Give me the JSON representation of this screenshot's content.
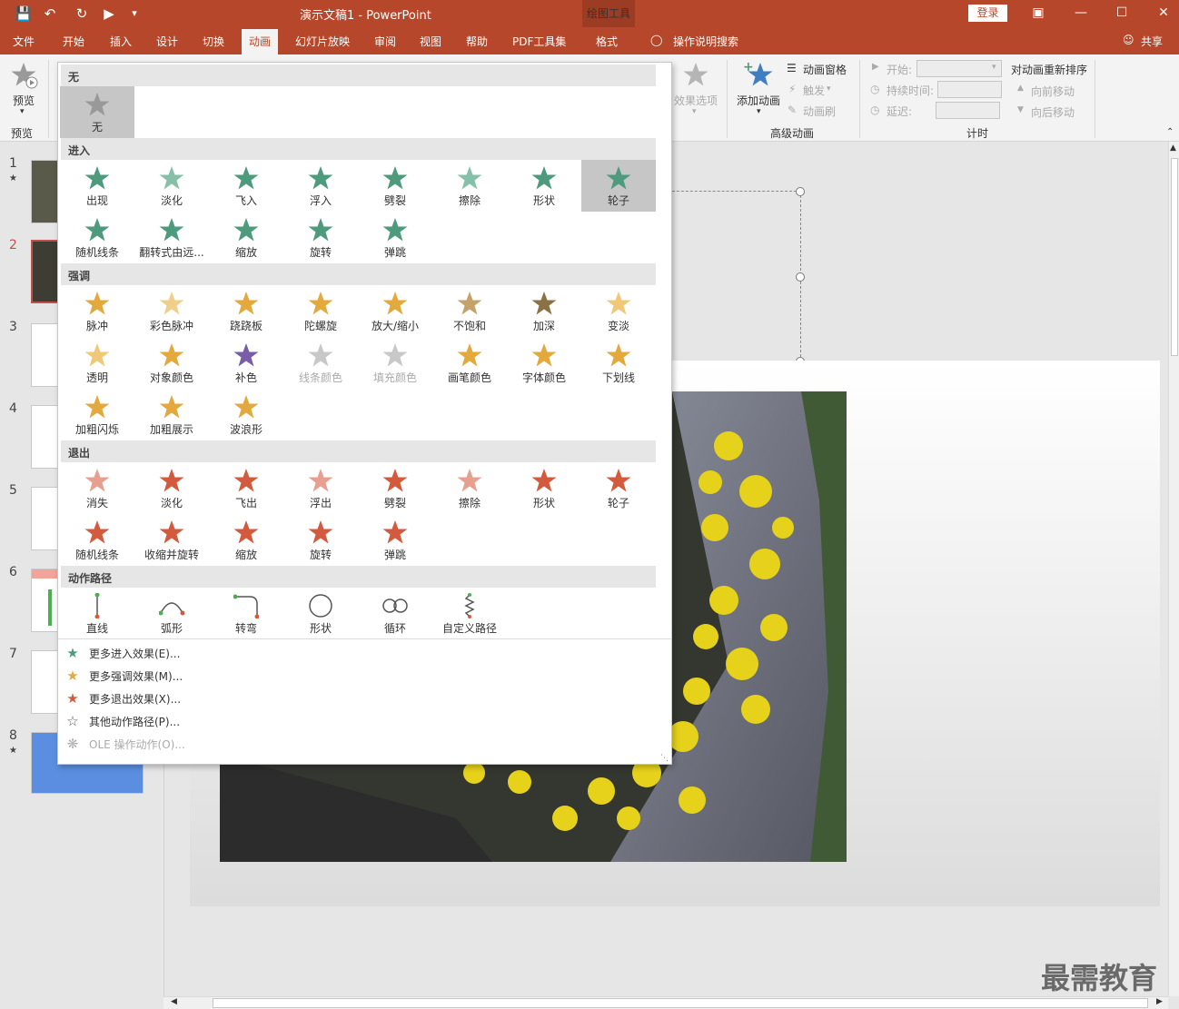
{
  "window": {
    "title": "演示文稿1 - PowerPoint",
    "context_group": "绘图工具",
    "login_label": "登录"
  },
  "tabs": [
    {
      "label": "文件"
    },
    {
      "label": "开始"
    },
    {
      "label": "插入"
    },
    {
      "label": "设计"
    },
    {
      "label": "切换"
    },
    {
      "label": "动画"
    },
    {
      "label": "幻灯片放映"
    },
    {
      "label": "审阅"
    },
    {
      "label": "视图"
    },
    {
      "label": "帮助"
    },
    {
      "label": "PDF工具集"
    },
    {
      "label": "格式"
    }
  ],
  "search_label": "操作说明搜索",
  "share_label": "共享",
  "ribbon": {
    "preview": "预览",
    "preview_group": "预览",
    "effect_options": "效果选项",
    "add_animation": "添加动画",
    "animation_pane": "动画窗格",
    "trigger": "触发",
    "animation_painter": "动画刷",
    "advanced_group": "高级动画",
    "start_label": "开始:",
    "duration_label": "持续时间:",
    "delay_label": "延迟:",
    "timing_group": "计时",
    "reorder_label": "对动画重新排序",
    "move_earlier": "向前移动",
    "move_later": "向后移动"
  },
  "gallery": {
    "sections": {
      "none": "无",
      "entrance": "进入",
      "emphasis": "强调",
      "exit": "退出",
      "paths": "动作路径"
    },
    "none": [
      {
        "label": "无",
        "color": "#999999"
      }
    ],
    "entrance": [
      {
        "label": "出现",
        "color": "#4e9a7c"
      },
      {
        "label": "淡化",
        "color": "#86c0a9"
      },
      {
        "label": "飞入",
        "color": "#4e9a7c"
      },
      {
        "label": "浮入",
        "color": "#4e9a7c"
      },
      {
        "label": "劈裂",
        "color": "#4e9a7c"
      },
      {
        "label": "擦除",
        "color": "#86c0a9"
      },
      {
        "label": "形状",
        "color": "#4e9a7c"
      },
      {
        "label": "轮子",
        "color": "#4e9a7c"
      },
      {
        "label": "随机线条",
        "color": "#4e9a7c"
      },
      {
        "label": "翻转式由远...",
        "color": "#4e9a7c"
      },
      {
        "label": "缩放",
        "color": "#4e9a7c"
      },
      {
        "label": "旋转",
        "color": "#4e9a7c"
      },
      {
        "label": "弹跳",
        "color": "#4e9a7c"
      }
    ],
    "emphasis": [
      {
        "label": "脉冲",
        "color": "#e3a93d"
      },
      {
        "label": "彩色脉冲",
        "color": "#f0cf8a"
      },
      {
        "label": "跷跷板",
        "color": "#e3a93d"
      },
      {
        "label": "陀螺旋",
        "color": "#e3a93d"
      },
      {
        "label": "放大/缩小",
        "color": "#e3a93d"
      },
      {
        "label": "不饱和",
        "color": "#c5a26a"
      },
      {
        "label": "加深",
        "color": "#8a7244"
      },
      {
        "label": "变淡",
        "color": "#f0c878"
      },
      {
        "label": "透明",
        "color": "#f0c878"
      },
      {
        "label": "对象颜色",
        "color": "#e3a93d"
      },
      {
        "label": "补色",
        "color": "#7a5da8"
      },
      {
        "label": "线条颜色",
        "color": "#c8c8c8"
      },
      {
        "label": "填充颜色",
        "color": "#c8c8c8"
      },
      {
        "label": "画笔颜色",
        "color": "#e3a93d"
      },
      {
        "label": "字体颜色",
        "color": "#e3a93d"
      },
      {
        "label": "下划线",
        "color": "#e3a93d"
      },
      {
        "label": "加粗闪烁",
        "color": "#e3a93d"
      },
      {
        "label": "加粗展示",
        "color": "#e3a93d"
      },
      {
        "label": "波浪形",
        "color": "#e3a93d"
      }
    ],
    "exit": [
      {
        "label": "消失",
        "color": "#e7a090"
      },
      {
        "label": "淡化",
        "color": "#d35a3c"
      },
      {
        "label": "飞出",
        "color": "#d35a3c"
      },
      {
        "label": "浮出",
        "color": "#e7a090"
      },
      {
        "label": "劈裂",
        "color": "#d35a3c"
      },
      {
        "label": "擦除",
        "color": "#e7a090"
      },
      {
        "label": "形状",
        "color": "#d35a3c"
      },
      {
        "label": "轮子",
        "color": "#d35a3c"
      },
      {
        "label": "随机线条",
        "color": "#d35a3c"
      },
      {
        "label": "收缩并旋转",
        "color": "#d35a3c"
      },
      {
        "label": "缩放",
        "color": "#d35a3c"
      },
      {
        "label": "旋转",
        "color": "#d35a3c"
      },
      {
        "label": "弹跳",
        "color": "#d35a3c"
      }
    ],
    "paths": [
      {
        "label": "直线"
      },
      {
        "label": "弧形"
      },
      {
        "label": "转弯"
      },
      {
        "label": "形状"
      },
      {
        "label": "循环"
      },
      {
        "label": "自定义路径"
      }
    ],
    "more": [
      {
        "label": "更多进入效果(E)...",
        "color": "#4e9a7c"
      },
      {
        "label": "更多强调效果(M)...",
        "color": "#e3a93d"
      },
      {
        "label": "更多退出效果(X)...",
        "color": "#d35a3c"
      },
      {
        "label": "其他动作路径(P)...",
        "color": "#555555"
      },
      {
        "label": "OLE 操作动作(O)...",
        "color": "#b0b0b0"
      }
    ]
  },
  "slides": [
    {
      "num": "1"
    },
    {
      "num": "2"
    },
    {
      "num": "3"
    },
    {
      "num": "4"
    },
    {
      "num": "5"
    },
    {
      "num": "6"
    },
    {
      "num": "7"
    },
    {
      "num": "8"
    }
  ],
  "watermark": "最需教育"
}
